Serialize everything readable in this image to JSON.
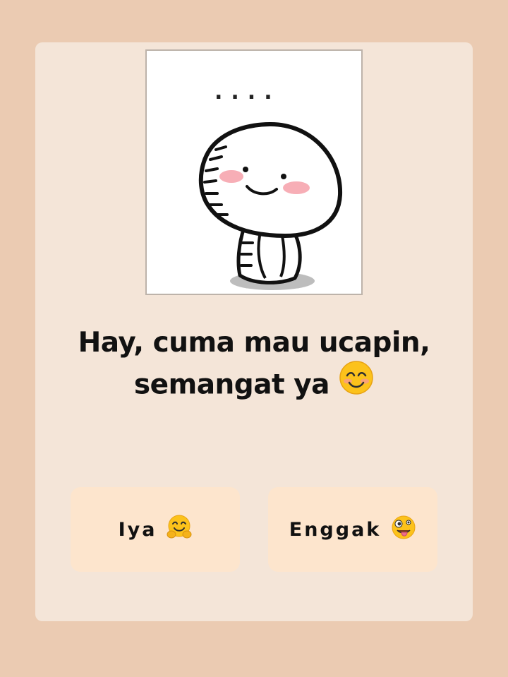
{
  "sticker": {
    "caption": "...."
  },
  "message": {
    "line1": "Hay, cuma mau ucapin,",
    "line2": "semangat ya",
    "emoji": "smiling-face-emoji"
  },
  "buttons": {
    "yes": {
      "label": "Iya",
      "emoji": "hugging-face-emoji"
    },
    "no": {
      "label": "Enggak",
      "emoji": "zany-face-emoji"
    }
  },
  "colors": {
    "page_background": "#ebcbb2",
    "card_background": "#f4e5d8",
    "button_background": "#fde5cd",
    "text": "#111111"
  }
}
